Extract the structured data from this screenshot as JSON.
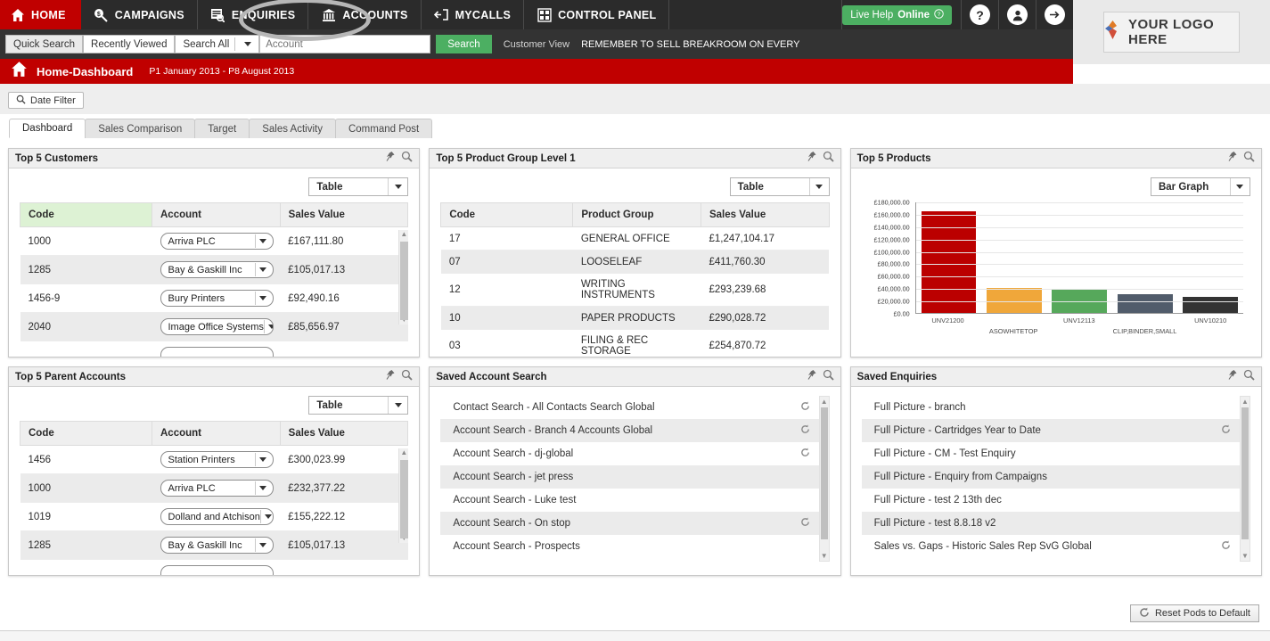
{
  "topnav": {
    "items": [
      {
        "label": "HOME",
        "icon": "home-icon",
        "active": true
      },
      {
        "label": "CAMPAIGNS",
        "icon": "campaign-icon",
        "active": false
      },
      {
        "label": "ENQUIRIES",
        "icon": "enquiries-icon",
        "active": false
      },
      {
        "label": "ACCOUNTS",
        "icon": "bank-icon",
        "active": false
      },
      {
        "label": "MYCALLS",
        "icon": "calls-icon",
        "active": false
      },
      {
        "label": "CONTROL PANEL",
        "icon": "control-panel-icon",
        "active": false
      }
    ],
    "live_help": "Live Help",
    "live_help_status": "Online",
    "help_icon_label": "?",
    "account_icon_label": "user-icon",
    "logout_icon_label": "logout-icon"
  },
  "logo": {
    "text": "YOUR LOGO HERE"
  },
  "search": {
    "quick_search": "Quick Search",
    "recently_viewed": "Recently Viewed",
    "scope": "Search All",
    "placeholder": "Account",
    "value": "",
    "button": "Search",
    "customer_view": "Customer View",
    "ticker": "REMEMBER TO SELL BREAKROOM ON EVERY"
  },
  "title": {
    "heading": "Home-Dashboard",
    "range": "P1 January 2013 - P8 August 2013",
    "date_filter": "Date Filter"
  },
  "tabs": [
    {
      "label": "Dashboard",
      "active": true
    },
    {
      "label": "Sales Comparison",
      "active": false
    },
    {
      "label": "Target",
      "active": false
    },
    {
      "label": "Sales Activity",
      "active": false
    },
    {
      "label": "Command Post",
      "active": false
    }
  ],
  "pods": {
    "top5_customers": {
      "title": "Top 5 Customers",
      "view": "Table",
      "columns": [
        "Code",
        "Account",
        "Sales Value"
      ],
      "rows": [
        {
          "code": "1000",
          "account": "Arriva PLC",
          "value": "£167,111.80"
        },
        {
          "code": "1285",
          "account": "Bay & Gaskill Inc",
          "value": "£105,017.13"
        },
        {
          "code": "1456-9",
          "account": "Bury Printers",
          "value": "£92,490.16"
        },
        {
          "code": "2040",
          "account": "Image Office Systems",
          "value": "£85,656.97"
        }
      ]
    },
    "top5_product_group": {
      "title": "Top 5 Product Group Level 1",
      "view": "Table",
      "columns": [
        "Code",
        "Product Group",
        "Sales Value"
      ],
      "rows": [
        {
          "code": "17",
          "group": "GENERAL OFFICE",
          "value": "£1,247,104.17"
        },
        {
          "code": "07",
          "group": "LOOSELEAF",
          "value": "£411,760.30"
        },
        {
          "code": "12",
          "group": "WRITING INSTRUMENTS",
          "value": "£293,239.68"
        },
        {
          "code": "10",
          "group": "PAPER PRODUCTS",
          "value": "£290,028.72"
        },
        {
          "code": "03",
          "group": "FILING & REC STORAGE",
          "value": "£254,870.72"
        }
      ]
    },
    "top5_products": {
      "title": "Top 5 Products",
      "view": "Bar Graph"
    },
    "top5_parent_accounts": {
      "title": "Top 5 Parent Accounts",
      "view": "Table",
      "columns": [
        "Code",
        "Account",
        "Sales Value"
      ],
      "rows": [
        {
          "code": "1456",
          "account": "Station Printers",
          "value": "£300,023.99"
        },
        {
          "code": "1000",
          "account": "Arriva PLC",
          "value": "£232,377.22"
        },
        {
          "code": "1019",
          "account": "Dolland and Atchison",
          "value": "£155,222.12"
        },
        {
          "code": "1285",
          "account": "Bay & Gaskill Inc",
          "value": "£105,017.13"
        }
      ]
    },
    "saved_account_search": {
      "title": "Saved Account Search",
      "rows": [
        {
          "label": "Contact Search - All Contacts Search Global",
          "refresh": true
        },
        {
          "label": "Account Search - Branch 4 Accounts Global",
          "refresh": true
        },
        {
          "label": "Account Search - dj-global",
          "refresh": true
        },
        {
          "label": "Account Search - jet press",
          "refresh": false
        },
        {
          "label": "Account Search - Luke test",
          "refresh": false
        },
        {
          "label": "Account Search - On stop",
          "refresh": true
        },
        {
          "label": "Account Search - Prospects",
          "refresh": false
        }
      ]
    },
    "saved_enquiries": {
      "title": "Saved Enquiries",
      "rows": [
        {
          "label": "Full Picture - branch",
          "refresh": false
        },
        {
          "label": "Full Picture - Cartridges Year to Date",
          "refresh": true
        },
        {
          "label": "Full Picture - CM - Test Enquiry",
          "refresh": false
        },
        {
          "label": "Full Picture - Enquiry from Campaigns",
          "refresh": false
        },
        {
          "label": "Full Picture - test 2 13th dec",
          "refresh": false
        },
        {
          "label": "Full Picture - test 8.8.18 v2",
          "refresh": false
        },
        {
          "label": "Sales vs. Gaps - Historic Sales Rep SvG Global",
          "refresh": true
        }
      ]
    }
  },
  "footer": {
    "reset_button": "Reset Pods to Default"
  },
  "colors": {
    "brand_red": "#c00000",
    "nav_dark": "#2b2b2b",
    "green": "#4caf62",
    "highlight_cell": "#ddf2d4"
  },
  "chart_data": {
    "type": "bar",
    "title": "Top 5 Products",
    "categories": [
      "UNV21200",
      "ASOWHITETOP",
      "UNV12113",
      "CLIP,BINDER,SMALL",
      "UNV10210"
    ],
    "values": [
      164000,
      40500,
      37500,
      30000,
      25500
    ],
    "colors": [
      "#bb0000",
      "#f0a73a",
      "#56a85b",
      "#515c6b",
      "#333333"
    ],
    "ytick_labels": [
      "£180,000.00",
      "£160,000.00",
      "£140,000.00",
      "£120,000.00",
      "£100,000.00",
      "£80,000.00",
      "£60,000.00",
      "£40,000.00",
      "£20,000.00",
      "£0.00"
    ],
    "ytick_values": [
      180000,
      160000,
      140000,
      120000,
      100000,
      80000,
      60000,
      40000,
      20000,
      0
    ],
    "ylim": [
      0,
      180000
    ],
    "xlabel": "",
    "ylabel": "",
    "grid": true,
    "legend": false
  }
}
